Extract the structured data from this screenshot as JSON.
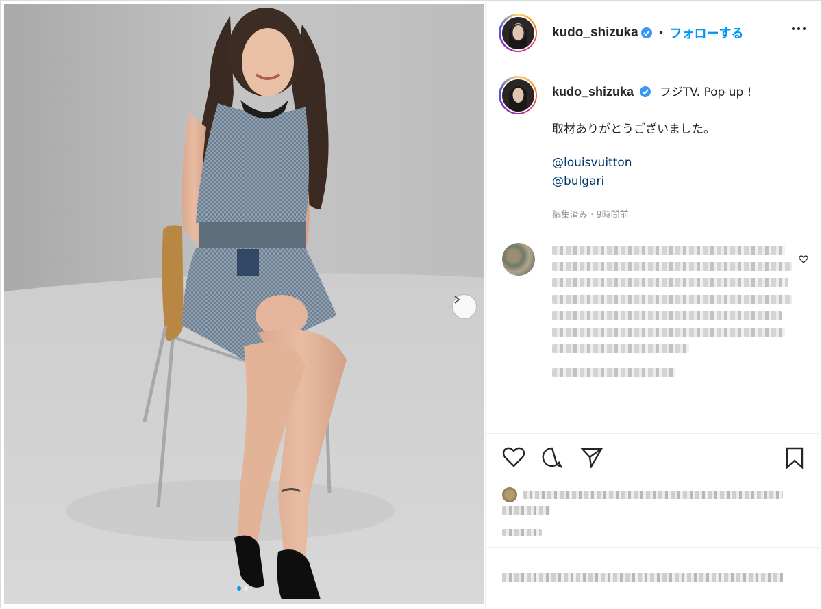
{
  "post": {
    "username": "kudo_shizuka",
    "follow_label": "フォローする",
    "separator": "•",
    "caption_title": "フジTV. Pop up !",
    "caption_line2": "取材ありがとうございました。",
    "mentions": [
      "@louisvuitton",
      "@bulgari"
    ],
    "meta": "編集済み · 9時間前"
  },
  "colors": {
    "accent": "#0095f6",
    "mention": "#00376b",
    "meta": "#8e8e8e",
    "text": "#262626"
  },
  "icons": {
    "verified": "verified-badge-icon",
    "more": "more-options-icon",
    "like": "heart-icon",
    "comment": "comment-icon",
    "share": "share-icon",
    "save": "bookmark-icon",
    "next": "chevron-right-icon"
  },
  "carousel": {
    "slide_count": 2,
    "current_slide": 1
  }
}
